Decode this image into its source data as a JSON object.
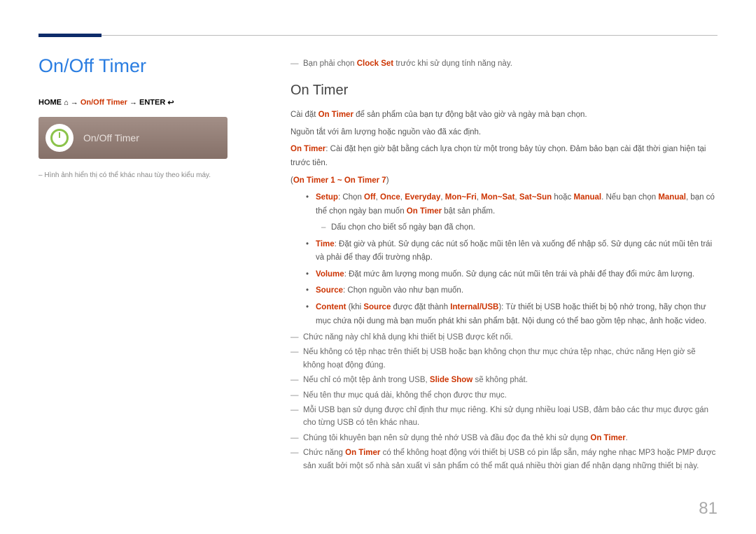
{
  "left": {
    "title": "On/Off Timer",
    "breadcrumb": {
      "home": "HOME",
      "arrow1": "→",
      "mid": "On/Off Timer",
      "arrow2": "→",
      "enter": "ENTER"
    },
    "preview_label": "On/Off Timer",
    "footnote": "Hình ảnh hiển thị có thể khác nhau tùy theo kiểu máy."
  },
  "right": {
    "pre_note_a": "Bạn phải chọn ",
    "pre_note_b": "Clock Set",
    "pre_note_c": " trước khi sử dụng tính năng này.",
    "section": "On Timer",
    "p1a": "Cài đặt ",
    "p1b": "On Timer",
    "p1c": " để sản phẩm của bạn tự động bật vào giờ và ngày mà bạn chọn.",
    "p2": "Nguồn tắt với âm lượng hoặc nguồn vào đã xác định.",
    "p3a": "On Timer",
    "p3b": ": Cài đặt hẹn giờ bật bằng cách lựa chọn từ một trong bảy tùy chọn. Đảm bảo bạn cài đặt thời gian hiện tại trước tiên.",
    "range": "On Timer 1 ~ On Timer 7",
    "setup_label": "Setup",
    "setup_a": ": Chọn ",
    "opt_off": "Off",
    "opt_once": "Once",
    "opt_everyday": "Everyday",
    "opt_monfri": "Mon~Fri",
    "opt_monsat": "Mon~Sat",
    "opt_satsun": "Sat~Sun",
    "opt_or": " hoặc ",
    "opt_manual": "Manual",
    "setup_b": ". Nếu bạn chọn ",
    "setup_c": ", bạn có thể chọn ngày bạn muốn ",
    "setup_d": "On Timer",
    "setup_e": " bật sản phẩm.",
    "setup_sub": "Dấu chọn cho biết số ngày bạn đã chọn.",
    "time_label": "Time",
    "time_text": ": Đặt giờ và phút. Sử dụng các nút số hoặc mũi tên lên và xuống để nhập số. Sử dụng các nút mũi tên trái và phải để thay đổi trường nhập.",
    "vol_label": "Volume",
    "vol_text": ": Đặt mức âm lượng mong muốn. Sử dụng các nút mũi tên trái và phải để thay đổi mức âm lượng.",
    "src_label": "Source",
    "src_text": ": Chọn nguồn vào như bạn muốn.",
    "cnt_label": "Content",
    "cnt_a": " (khi ",
    "cnt_src": "Source",
    "cnt_b": " được đặt thành ",
    "cnt_internal": "Internal/USB",
    "cnt_c": "): Từ thiết bị USB hoặc thiết bị bộ nhớ trong, hãy chọn thư mục chứa nội dung mà bạn muốn phát khi sản phẩm bật. Nội dung có thể bao gồm tệp nhạc, ảnh hoặc video.",
    "n1": "Chức năng này chỉ khả dụng khi thiết bị USB được kết nối.",
    "n2": "Nếu không có tệp nhạc trên thiết bị USB hoặc bạn không chọn thư mục chứa tệp nhạc, chức năng Hẹn giờ sẽ không hoạt động đúng.",
    "n3a": "Nếu chỉ có một tệp ảnh trong USB, ",
    "n3b": "Slide Show",
    "n3c": " sẽ không phát.",
    "n4": "Nếu tên thư mục quá dài, không thể chọn được thư mục.",
    "n5": "Mỗi USB bạn sử dụng được chỉ định thư mục riêng. Khi sử dụng nhiều loại USB, đảm bảo các thư mục được gán cho từng USB có tên khác nhau.",
    "n6a": "Chúng tôi khuyên bạn nên sử dụng thẻ nhớ USB và đầu đọc đa thẻ khi sử dụng ",
    "n6b": "On Timer",
    "n6c": ".",
    "n7a": "Chức năng ",
    "n7b": "On Timer",
    "n7c": " có thể không hoạt động với thiết bị USB có pin lắp sẵn, máy nghe nhạc MP3 hoặc PMP được sản xuất bởi một số nhà sản xuất vì sản phẩm có thể mất quá nhiều thời gian để nhận dạng những thiết bị này."
  },
  "page_number": "81"
}
